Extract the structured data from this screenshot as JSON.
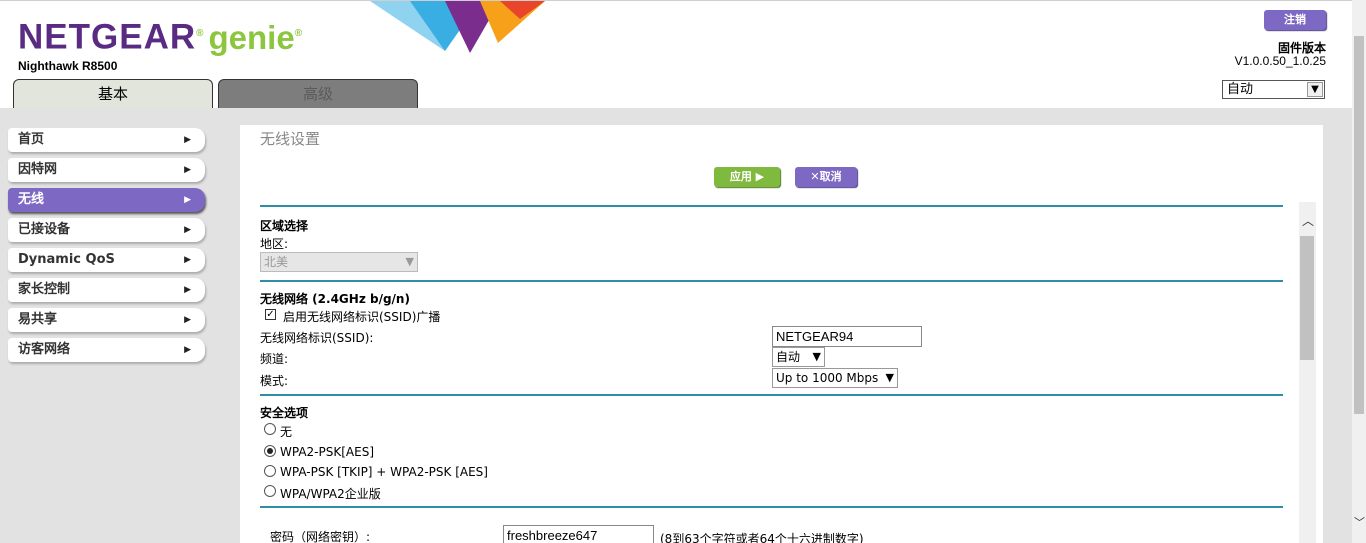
{
  "header": {
    "brand": "NETGEAR",
    "brand_suffix": "genie",
    "model": "Nighthawk R8500",
    "logout_label": "注销",
    "firmware_label": "固件版本",
    "firmware_version": "V1.0.0.50_1.0.25",
    "language": "自动"
  },
  "tabs": [
    {
      "label": "基本",
      "active": true
    },
    {
      "label": "高级",
      "active": false
    }
  ],
  "sidebar": {
    "items": [
      {
        "label": "首页"
      },
      {
        "label": "因特网"
      },
      {
        "label": "无线",
        "active": true
      },
      {
        "label": "已接设备"
      },
      {
        "label": "Dynamic QoS"
      },
      {
        "label": "家长控制"
      },
      {
        "label": "易共享"
      },
      {
        "label": "访客网络"
      }
    ]
  },
  "content": {
    "title": "无线设置",
    "apply_label": "应用 ▶",
    "cancel_label": "✕取消",
    "region": {
      "heading": "区域选择",
      "label": "地区:",
      "value": "北美"
    },
    "wireless": {
      "heading": "无线网络 (2.4GHz b/g/n)",
      "broadcast_label": "启用无线网络标识(SSID)广播",
      "broadcast_checked": true,
      "ssid_label": "无线网络标识(SSID):",
      "ssid_value": "NETGEAR94",
      "channel_label": "频道:",
      "channel_value": "自动",
      "mode_label": "模式:",
      "mode_value": "Up to 1000 Mbps"
    },
    "security": {
      "heading": "安全选项",
      "options": [
        {
          "label": "无",
          "selected": false
        },
        {
          "label": "WPA2-PSK[AES]",
          "selected": true
        },
        {
          "label": "WPA-PSK [TKIP] + WPA2-PSK [AES]",
          "selected": false
        },
        {
          "label": "WPA/WPA2企业版",
          "selected": false
        }
      ],
      "password_label": "密码（网络密钥）:",
      "password_value": "freshbreeze647",
      "password_hint": "(8到63个字符或者64个十六进制数字)"
    }
  },
  "colors": {
    "brand_purple": "#5a2b82",
    "genie_green": "#8cc63f",
    "accent_purple": "#7d69c4",
    "apply_green": "#7fb93d",
    "divider_teal": "#2f8ea3"
  }
}
